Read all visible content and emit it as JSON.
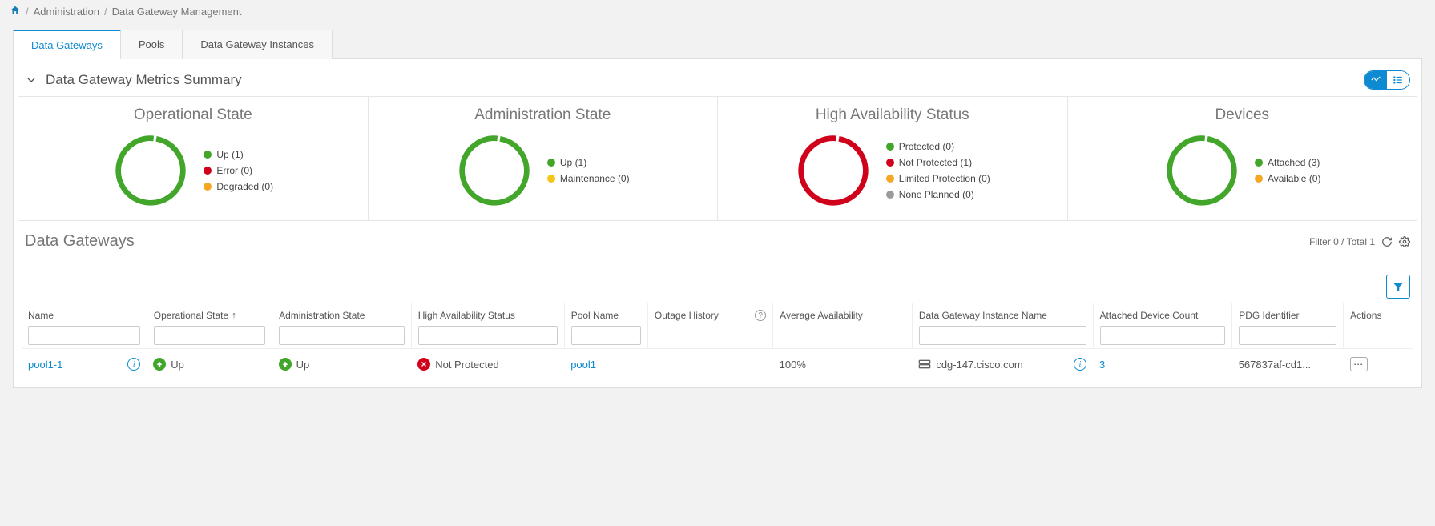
{
  "breadcrumb": {
    "level1": "Administration",
    "level2": "Data Gateway Management"
  },
  "tabs": [
    {
      "label": "Data Gateways"
    },
    {
      "label": "Pools"
    },
    {
      "label": "Data Gateway Instances"
    }
  ],
  "summary": {
    "title": "Data Gateway Metrics Summary",
    "cards": {
      "operational": {
        "title": "Operational State",
        "legend": [
          {
            "label": "Up",
            "value": 1,
            "color": "#41a62a"
          },
          {
            "label": "Error",
            "value": 0,
            "color": "#d0021b"
          },
          {
            "label": "Degraded",
            "value": 0,
            "color": "#f5a623"
          }
        ],
        "ring_color": "#41a62a"
      },
      "admin": {
        "title": "Administration State",
        "legend": [
          {
            "label": "Up",
            "value": 1,
            "color": "#41a62a"
          },
          {
            "label": "Maintenance",
            "value": 0,
            "color": "#f5c518"
          }
        ],
        "ring_color": "#41a62a"
      },
      "ha": {
        "title": "High Availability Status",
        "legend": [
          {
            "label": "Protected",
            "value": 0,
            "color": "#41a62a"
          },
          {
            "label": "Not Protected",
            "value": 1,
            "color": "#d0021b"
          },
          {
            "label": "Limited Protection",
            "value": 0,
            "color": "#f5a623"
          },
          {
            "label": "None Planned",
            "value": 0,
            "color": "#9b9b9b"
          }
        ],
        "ring_color": "#d0021b"
      },
      "devices": {
        "title": "Devices",
        "legend": [
          {
            "label": "Attached",
            "value": 3,
            "color": "#41a62a"
          },
          {
            "label": "Available",
            "value": 0,
            "color": "#f5a623"
          }
        ],
        "ring_color": "#41a62a"
      }
    }
  },
  "section": {
    "title": "Data Gateways",
    "filter_text": "Filter 0 / Total 1"
  },
  "columns": {
    "name": "Name",
    "op_state": "Operational State",
    "admin_state": "Administration State",
    "ha_status": "High Availability Status",
    "pool": "Pool Name",
    "outage": "Outage History",
    "avg_avail": "Average Availability",
    "instance": "Data Gateway Instance Name",
    "attached": "Attached Device Count",
    "pdg": "PDG Identifier",
    "actions": "Actions"
  },
  "rows": [
    {
      "name": "pool1-1",
      "op_state": "Up",
      "admin_state": "Up",
      "ha_status": "Not Protected",
      "pool": "pool1",
      "outage": "",
      "avg_avail": "100%",
      "instance": "cdg-147.cisco.com",
      "attached": "3",
      "pdg": "567837af-cd1..."
    }
  ]
}
